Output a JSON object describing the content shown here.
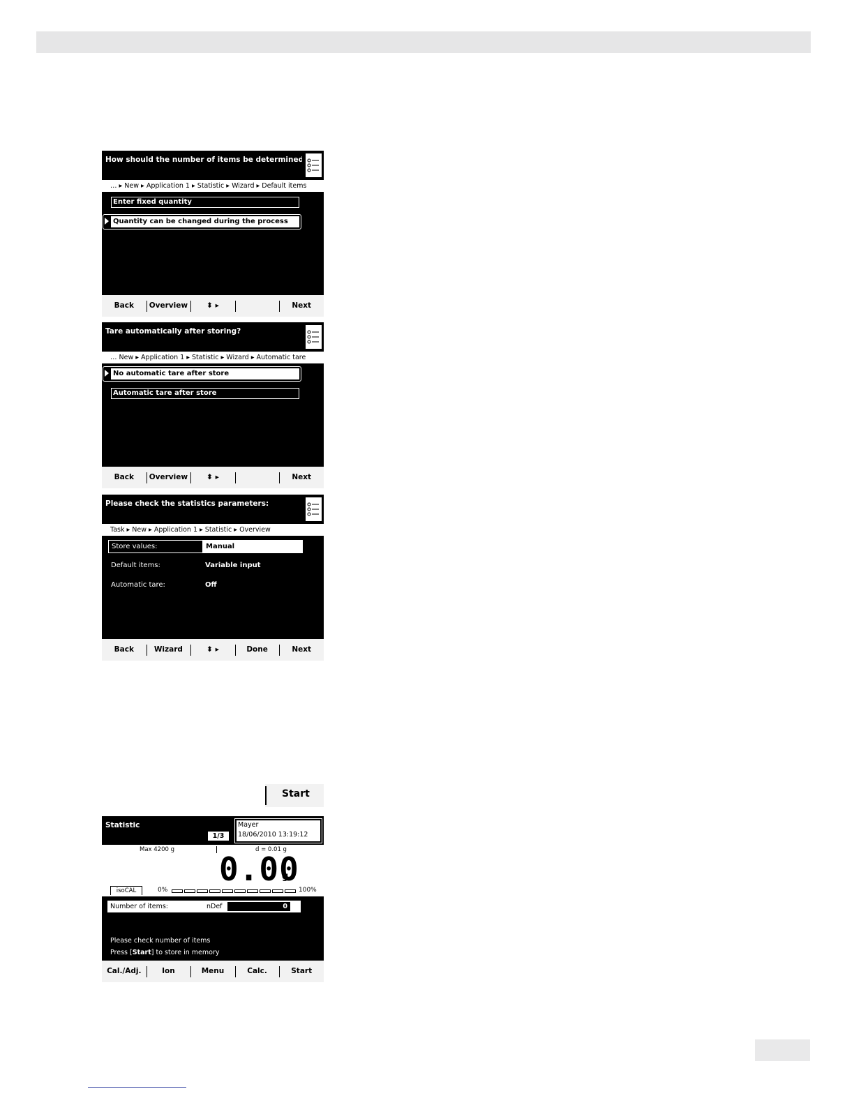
{
  "screen1": {
    "title": "How should the number of items be determined…",
    "breadcrumb": "… ▸ New ▸ Application 1 ▸ Statistic ▸ Wizard ▸ Default items",
    "options": [
      "Enter fixed quantity",
      "Quantity can be changed during the process"
    ],
    "selected_index": 1,
    "softkeys": [
      "Back",
      "Overview",
      "⬍ ▸",
      "",
      "Next"
    ]
  },
  "screen2": {
    "title": "Tare automatically after storing?",
    "breadcrumb": "… New ▸ Application 1 ▸ Statistic ▸ Wizard ▸ Automatic tare",
    "options": [
      "No automatic tare after store",
      "Automatic tare after store"
    ],
    "selected_index": 0,
    "softkeys": [
      "Back",
      "Overview",
      "⬍ ▸",
      "",
      "Next"
    ]
  },
  "screen3": {
    "title": "Please check the statistics parameters:",
    "breadcrumb": "Task ▸ New ▸ Application 1 ▸ Statistic ▸ Overview",
    "params": [
      {
        "label": "Store values:",
        "value": "Manual"
      },
      {
        "label": "Default items:",
        "value": "Variable input"
      },
      {
        "label": "Automatic tare:",
        "value": "Off"
      }
    ],
    "softkeys": [
      "Back",
      "Wizard",
      "⬍ ▸",
      "Done",
      "Next"
    ]
  },
  "start_key": {
    "label": "Start"
  },
  "statistic": {
    "title": "Statistic",
    "page": "1/3",
    "user": "Mayer",
    "datetime": "18/06/2010 13:19:12",
    "max": "Max 4200 g",
    "d": "d = 0.01 g",
    "reading": "0.00",
    "unit": "g",
    "isocal": "isoCAL",
    "pct_min": "0%",
    "pct_max": "100%",
    "load_fraction": 0,
    "items_label": "Number of items:",
    "items_ndef": "nDef",
    "items_value": "0",
    "message1": "Please check number of items",
    "message2_pre": "Press [",
    "message2_key": "Start",
    "message2_post": "] to store in memory",
    "softkeys": [
      "Cal./Adj.",
      "Ion",
      "Menu",
      "Calc.",
      "Start"
    ]
  }
}
